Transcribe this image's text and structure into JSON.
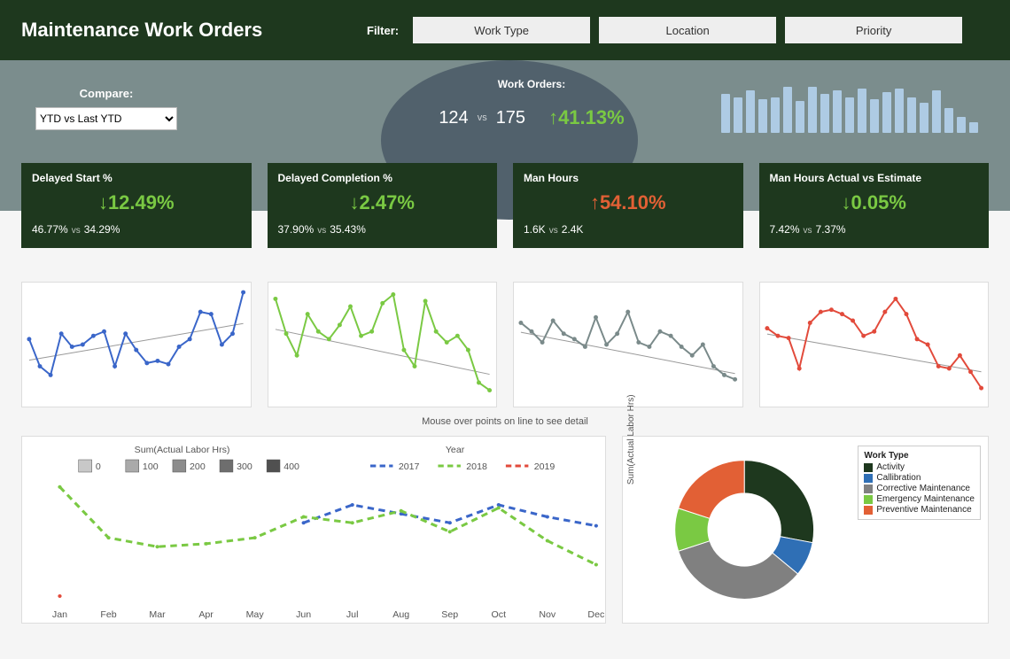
{
  "header": {
    "title": "Maintenance Work Orders",
    "filter_label": "Filter:",
    "filters": [
      "Work Type",
      "Location",
      "Priority"
    ]
  },
  "compare": {
    "label": "Compare:",
    "selected": "YTD vs Last YTD"
  },
  "work_orders": {
    "title": "Work Orders:",
    "a": "124",
    "b": "175",
    "vs": "vs",
    "delta": "↑41.13%"
  },
  "spark_bars": [
    44,
    40,
    48,
    38,
    40,
    52,
    36,
    52,
    44,
    48,
    40,
    50,
    38,
    46,
    50,
    40,
    34,
    48,
    28,
    18,
    12
  ],
  "cards": [
    {
      "title": "Delayed Start %",
      "delta": "↓12.49%",
      "class": "green",
      "a": "46.77%",
      "b": "34.29%"
    },
    {
      "title": "Delayed Completion %",
      "delta": "↓2.47%",
      "class": "green",
      "a": "37.90%",
      "b": "35.43%"
    },
    {
      "title": "Man Hours",
      "delta": "↑54.10%",
      "class": "red",
      "a": "1.6K",
      "b": "2.4K"
    },
    {
      "title": "Man Hours Actual vs Estimate",
      "delta": "↓0.05%",
      "class": "green",
      "a": "7.42%",
      "b": "7.37%"
    }
  ],
  "chart_data": {
    "kpi_sparklines": [
      {
        "name": "Delayed Start %",
        "color": "#3a66c9",
        "values": [
          55,
          30,
          22,
          60,
          48,
          50,
          58,
          62,
          30,
          60,
          45,
          33,
          35,
          32,
          48,
          55,
          80,
          78,
          50,
          60,
          98
        ]
      },
      {
        "name": "Delayed Completion %",
        "color": "#7ac943",
        "values": [
          92,
          60,
          40,
          78,
          62,
          55,
          68,
          85,
          58,
          62,
          88,
          96,
          45,
          30,
          90,
          62,
          52,
          58,
          45,
          15,
          8
        ]
      },
      {
        "name": "Man Hours",
        "color": "#7a8a8a",
        "values": [
          70,
          62,
          52,
          72,
          60,
          55,
          48,
          75,
          50,
          60,
          80,
          52,
          48,
          62,
          58,
          48,
          40,
          50,
          30,
          22,
          18
        ]
      },
      {
        "name": "Man Hours Actual vs Estimate",
        "color": "#e24a3b",
        "values": [
          65,
          58,
          56,
          28,
          70,
          80,
          82,
          78,
          72,
          58,
          62,
          80,
          92,
          78,
          55,
          50,
          30,
          28,
          40,
          25,
          10
        ]
      }
    ],
    "labor_by_month": {
      "type": "line",
      "title_left": "Sum(Actual  Labor Hrs)",
      "title_right": "Year",
      "size_legend": [
        0,
        100,
        200,
        300,
        400
      ],
      "months": [
        "Jan",
        "Feb",
        "Mar",
        "Apr",
        "May",
        "Jun",
        "Jul",
        "Aug",
        "Sep",
        "Oct",
        "Nov",
        "Dec"
      ],
      "series": [
        {
          "name": "2017",
          "color": "#3a66c9",
          "values": [
            null,
            null,
            null,
            null,
            null,
            260,
            320,
            290,
            260,
            320,
            280,
            250
          ]
        },
        {
          "name": "2018",
          "color": "#7ac943",
          "values": [
            380,
            210,
            180,
            190,
            210,
            280,
            260,
            300,
            230,
            310,
            200,
            120
          ]
        },
        {
          "name": "2019",
          "color": "#e24a3b",
          "values": [
            15,
            null,
            null,
            null,
            null,
            null,
            null,
            null,
            null,
            null,
            null,
            null
          ]
        }
      ],
      "ylim": [
        0,
        400
      ]
    },
    "work_type_donut": {
      "type": "pie",
      "ylabel": "Sum(Actual  Labor Hrs)",
      "legend_title": "Work Type",
      "slices": [
        {
          "name": "Activity",
          "color": "#1e381e",
          "value": 28
        },
        {
          "name": "Callibration",
          "color": "#2f6fb5",
          "value": 8
        },
        {
          "name": "Corrective Maintenance",
          "color": "#808080",
          "value": 34
        },
        {
          "name": "Emergency Maintenance",
          "color": "#7ac943",
          "value": 10
        },
        {
          "name": "Preventive Maintenance",
          "color": "#e26035",
          "value": 20
        }
      ]
    }
  },
  "hint": "Mouse over points on line to see detail"
}
